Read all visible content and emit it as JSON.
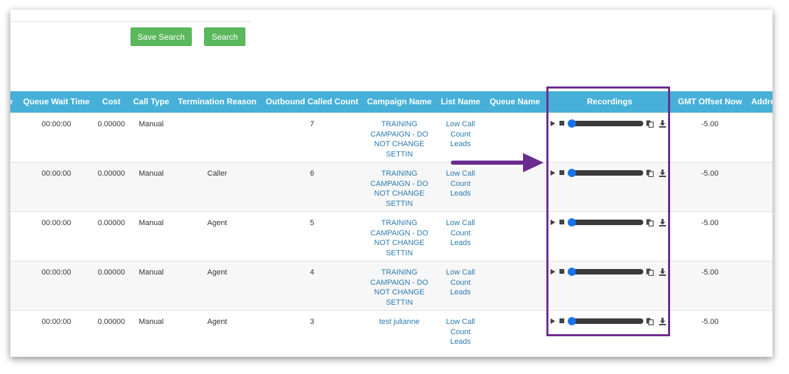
{
  "toolbar": {
    "save_search_label": "Save Search",
    "search_label": "Search"
  },
  "table": {
    "headers": [
      "e",
      "Queue Wait Time",
      "Cost",
      "Call Type",
      "Termination Reason",
      "Outbound Called Count",
      "Campaign Name",
      "List Name",
      "Queue Name",
      "Recordings",
      "GMT Offset Now",
      "Addre"
    ],
    "rows": [
      {
        "queue_wait_time": "00:00:00",
        "cost": "0.00000",
        "call_type": "Manual",
        "termination_reason": "",
        "outbound_called_count": "7",
        "campaign_name": [
          "TRAINING",
          "CAMPAIGN - DO",
          "NOT CHANGE",
          "SETTIN"
        ],
        "list_name": [
          "Low Call",
          "Count",
          "Leads"
        ],
        "gmt_offset": "-5.00"
      },
      {
        "queue_wait_time": "00:00:00",
        "cost": "0.00000",
        "call_type": "Manual",
        "termination_reason": "Caller",
        "outbound_called_count": "6",
        "campaign_name": [
          "TRAINING",
          "CAMPAIGN - DO",
          "NOT CHANGE",
          "SETTIN"
        ],
        "list_name": [
          "Low Call",
          "Count",
          "Leads"
        ],
        "gmt_offset": "-5.00"
      },
      {
        "queue_wait_time": "00:00:00",
        "cost": "0.00000",
        "call_type": "Manual",
        "termination_reason": "Agent",
        "outbound_called_count": "5",
        "campaign_name": [
          "TRAINING",
          "CAMPAIGN - DO",
          "NOT CHANGE",
          "SETTIN"
        ],
        "list_name": [
          "Low Call",
          "Count",
          "Leads"
        ],
        "gmt_offset": "-5.00"
      },
      {
        "queue_wait_time": "00:00:00",
        "cost": "0.00000",
        "call_type": "Manual",
        "termination_reason": "Agent",
        "outbound_called_count": "4",
        "campaign_name": [
          "TRAINING",
          "CAMPAIGN - DO",
          "NOT CHANGE",
          "SETTIN"
        ],
        "list_name": [
          "Low Call",
          "Count",
          "Leads"
        ],
        "gmt_offset": "-5.00"
      },
      {
        "queue_wait_time": "00:00:00",
        "cost": "0.00000",
        "call_type": "Manual",
        "termination_reason": "Agent",
        "outbound_called_count": "3",
        "campaign_name": [
          "test julianne"
        ],
        "list_name": [
          "Low Call",
          "Count",
          "Leads"
        ],
        "gmt_offset": "-5.00"
      }
    ]
  },
  "icons": {
    "play": "play-icon",
    "stop": "stop-icon",
    "copy": "copy-icon",
    "download": "download-icon"
  },
  "colors": {
    "header_bg": "#46b0d9",
    "button_green": "#5cb85c",
    "link": "#2a7ab0",
    "highlight": "#6a2c8e",
    "slider_thumb": "#1a73e8"
  }
}
